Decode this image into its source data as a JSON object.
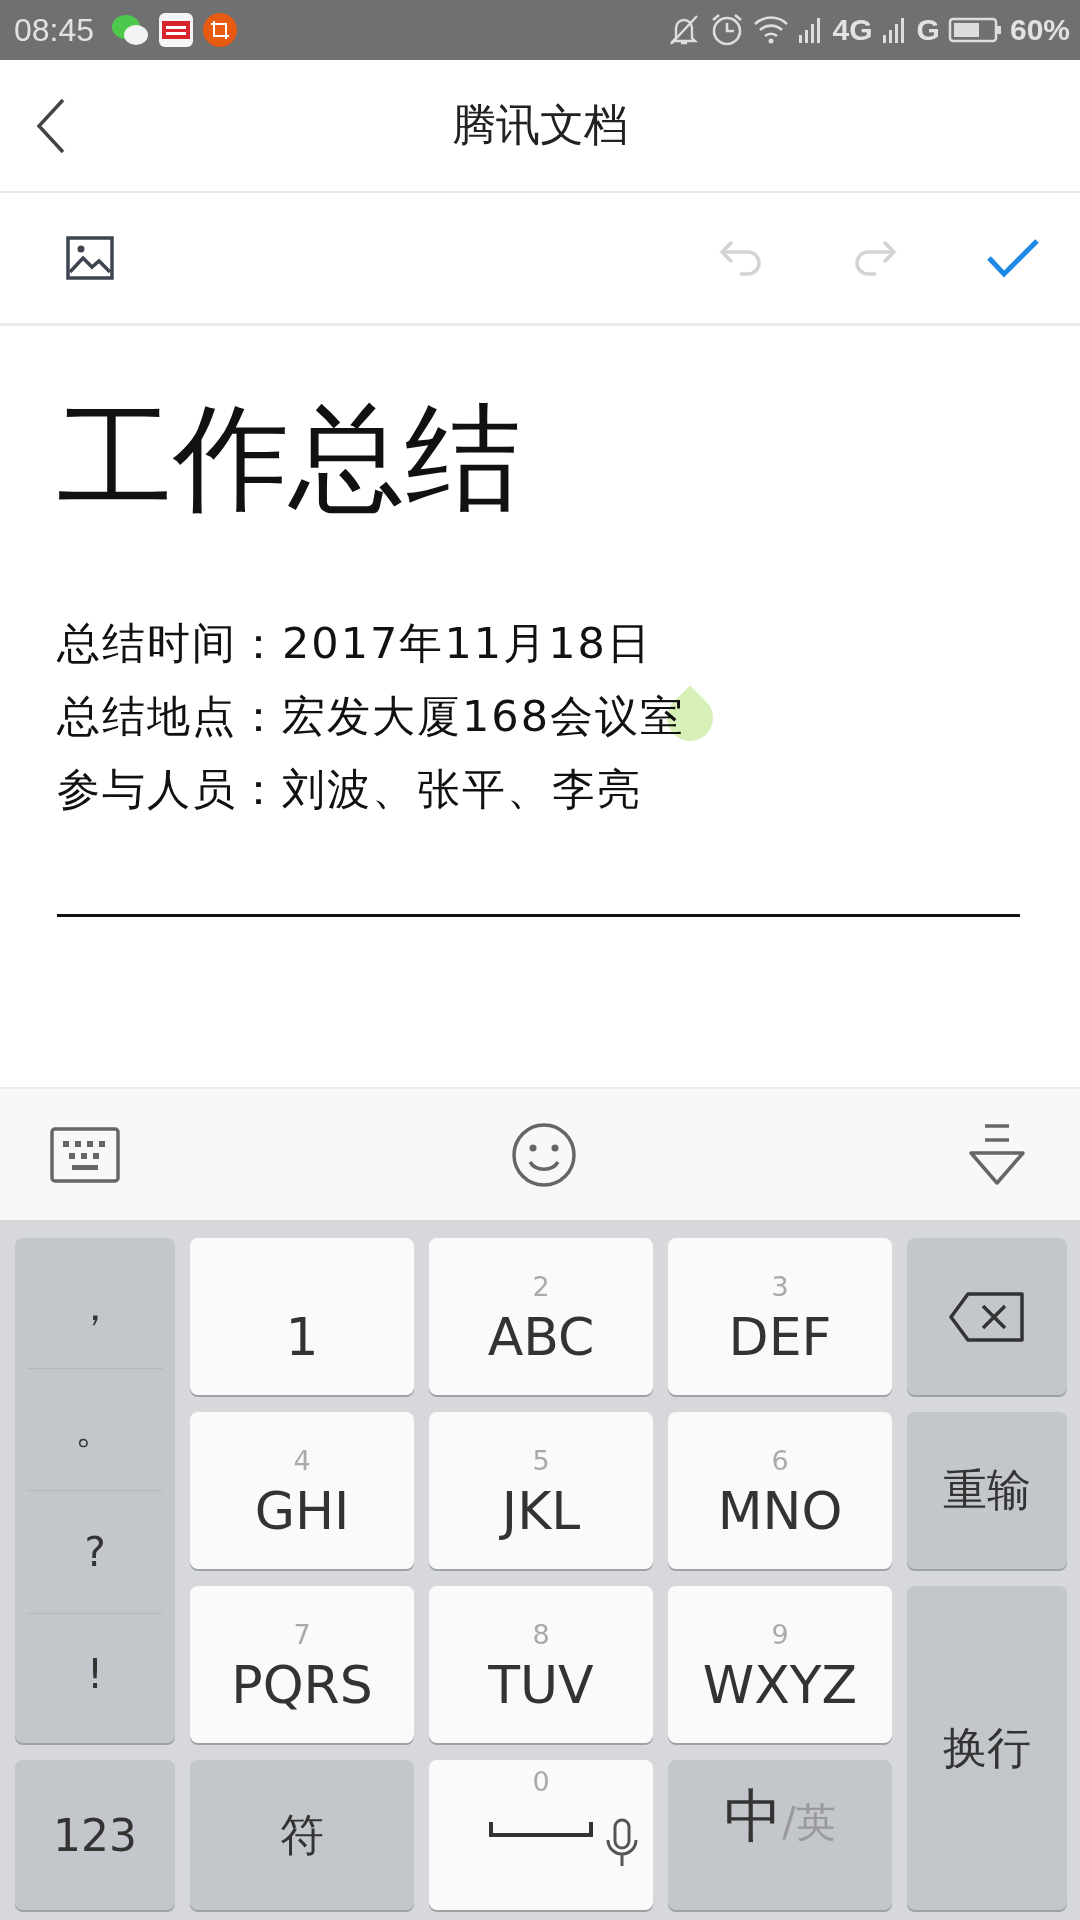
{
  "status_bar": {
    "time": "08:45",
    "network_1": "4G",
    "network_2": "G",
    "battery": "60%"
  },
  "header": {
    "title": "腾讯文档"
  },
  "toolbar": {
    "undo_disabled": true,
    "redo_disabled": true
  },
  "document": {
    "title": "工作总结",
    "lines": [
      {
        "label": "总结时间：",
        "value": "2017年11月18日"
      },
      {
        "label": "总结地点：",
        "value": "宏发大厦168会议室"
      },
      {
        "label": "参与人员：",
        "value": "刘波、张平、李亮"
      }
    ]
  },
  "keyboard": {
    "keys": [
      {
        "kind": "symbols",
        "items": [
          "，",
          "。",
          "?",
          "!"
        ]
      },
      {
        "kind": "key",
        "label": "1"
      },
      {
        "kind": "key",
        "digit": "2",
        "label": "ABC"
      },
      {
        "kind": "key",
        "digit": "3",
        "label": "DEF"
      },
      {
        "kind": "backspace"
      },
      {
        "kind": "key",
        "digit": "4",
        "label": "GHI"
      },
      {
        "kind": "key",
        "digit": "5",
        "label": "JKL"
      },
      {
        "kind": "key",
        "digit": "6",
        "label": "MNO"
      },
      {
        "kind": "function",
        "label": "重输"
      },
      {
        "kind": "key",
        "digit": "7",
        "label": "PQRS"
      },
      {
        "kind": "key",
        "digit": "8",
        "label": "TUV"
      },
      {
        "kind": "key",
        "digit": "9",
        "label": "WXYZ"
      },
      {
        "kind": "enter",
        "label": "换行"
      },
      {
        "kind": "function",
        "label": "123"
      },
      {
        "kind": "function",
        "label": "符"
      },
      {
        "kind": "space",
        "digit": "0"
      },
      {
        "kind": "lang",
        "label": "中",
        "sub": "/英"
      }
    ]
  }
}
